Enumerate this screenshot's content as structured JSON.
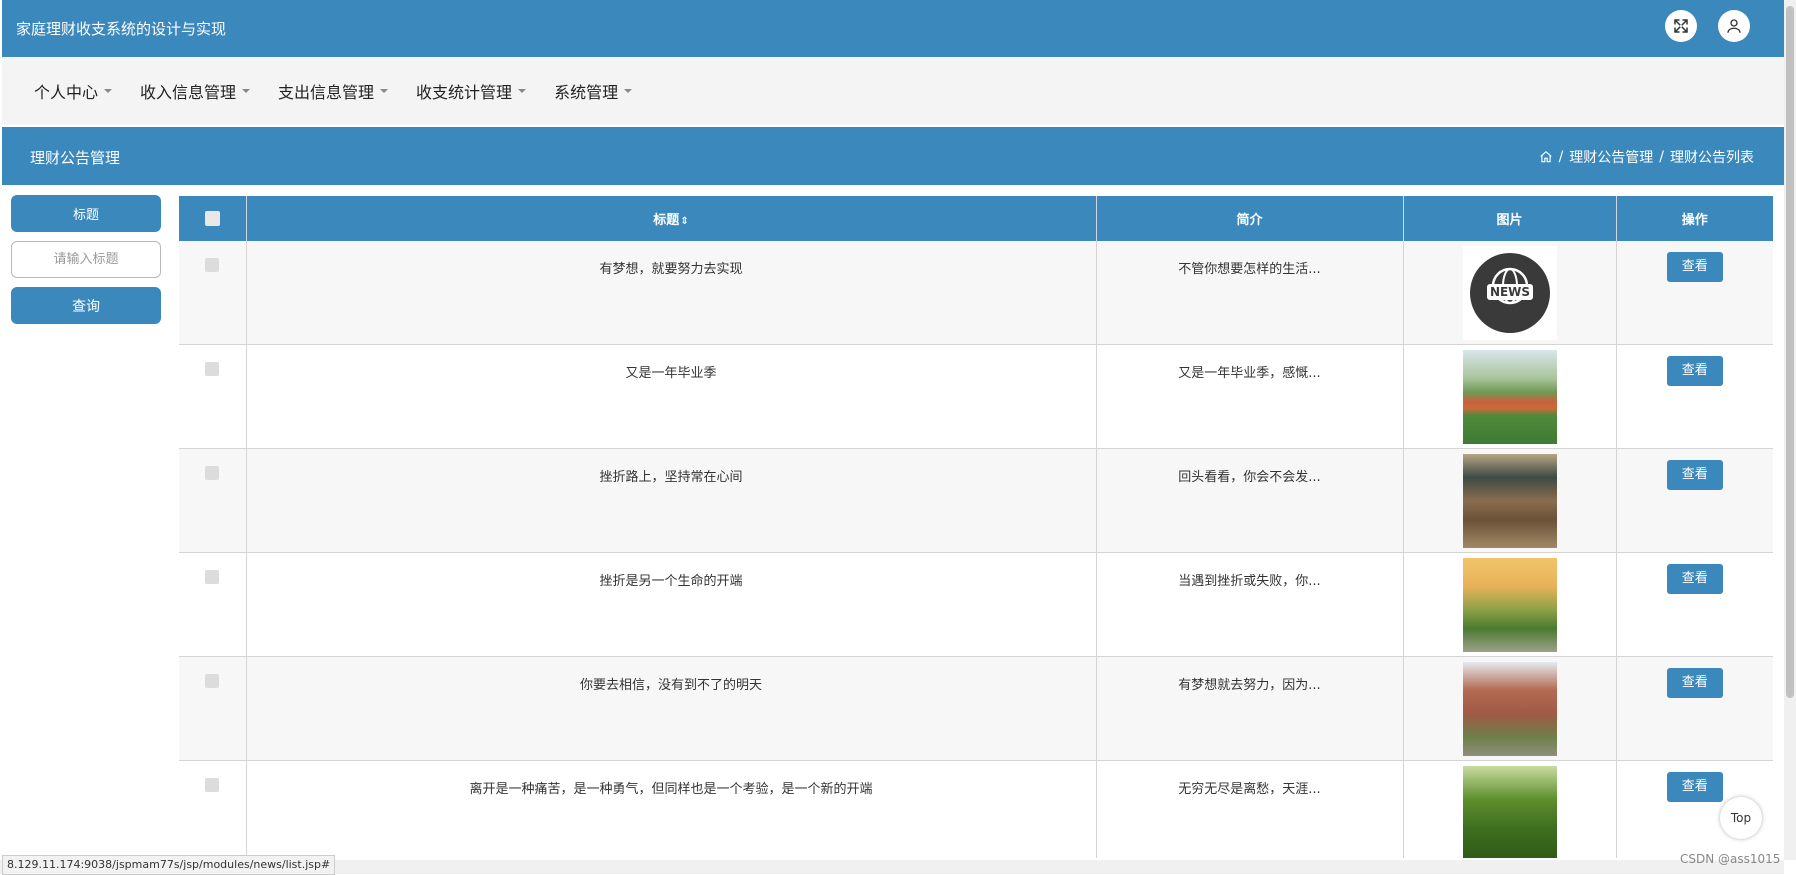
{
  "header": {
    "title": "家庭理财收支系统的设计与实现",
    "fullscreen_icon": "expand-icon",
    "user_icon": "user-icon"
  },
  "nav": {
    "items": [
      {
        "label": "个人中心"
      },
      {
        "label": "收入信息管理"
      },
      {
        "label": "支出信息管理"
      },
      {
        "label": "收支统计管理"
      },
      {
        "label": "系统管理"
      }
    ]
  },
  "crumb": {
    "page_title": "理财公告管理",
    "home_icon": "home-icon",
    "sep": "/",
    "level1": "理财公告管理",
    "level2": "理财公告列表"
  },
  "search": {
    "label": "标题",
    "placeholder": "请输入标题",
    "button": "查询"
  },
  "table": {
    "columns": {
      "title": "标题",
      "sort_icon": "⇕",
      "summary": "简介",
      "image": "图片",
      "action": "操作"
    },
    "rows": [
      {
        "title": "有梦想，就要努力去实现",
        "summary": "不管你想要怎样的生活...",
        "image_name": "news-logo-image",
        "action": "查看"
      },
      {
        "title": "又是一年毕业季",
        "summary": "又是一年毕业季，感慨...",
        "image_name": "campus-field-image",
        "action": "查看"
      },
      {
        "title": "挫折路上，坚持常在心间",
        "summary": "回头看看，你会不会发...",
        "image_name": "classroom-image",
        "action": "查看"
      },
      {
        "title": "挫折是另一个生命的开端",
        "summary": "当遇到挫折或失败，你...",
        "image_name": "campus-sunset-image",
        "action": "查看"
      },
      {
        "title": "你要去相信，没有到不了的明天",
        "summary": "有梦想就去努力，因为...",
        "image_name": "campus-building-image",
        "action": "查看"
      },
      {
        "title": "离开是一种痛苦，是一种勇气，但同样也是一个考验，是一个新的开端",
        "summary": "无穷无尽是离愁，天涯...",
        "image_name": "tree-path-image",
        "action": "查看"
      }
    ]
  },
  "top_button": "Top",
  "status_url": "8.129.11.174:9038/jspmam77s/jsp/modules/news/list.jsp#",
  "watermark": "CSDN @ass1015",
  "colors": {
    "primary": "#3b88bd",
    "nav_bg": "#f4f4f4"
  }
}
